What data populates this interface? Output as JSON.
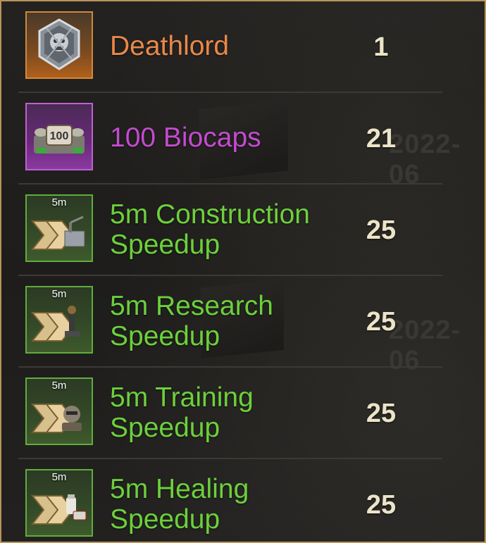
{
  "colors": {
    "frame_border": "#b8935a",
    "orange_text": "#e9884a",
    "purple_text": "#c44bd0",
    "green_text": "#6cd03c",
    "count_text": "#ece4c8"
  },
  "background": {
    "date_watermark_1": "2022-06",
    "date_watermark_2": "2022-06"
  },
  "items": [
    {
      "name_lines": [
        "Deathlord"
      ],
      "count": "1",
      "rarity": "orange",
      "icon": "deathlord-emblem-icon",
      "badge": ""
    },
    {
      "name_lines": [
        "100 Biocaps"
      ],
      "count": "21",
      "rarity": "purple",
      "icon": "biocaps-stack-icon",
      "badge": ""
    },
    {
      "name_lines": [
        "5m Construction",
        "Speedup"
      ],
      "count": "25",
      "rarity": "green",
      "icon": "construction-speedup-icon",
      "badge": "5m"
    },
    {
      "name_lines": [
        "5m Research",
        "Speedup"
      ],
      "count": "25",
      "rarity": "green",
      "icon": "research-speedup-icon",
      "badge": "5m"
    },
    {
      "name_lines": [
        "5m Training",
        "Speedup"
      ],
      "count": "25",
      "rarity": "green",
      "icon": "training-speedup-icon",
      "badge": "5m"
    },
    {
      "name_lines": [
        "5m Healing",
        "Speedup"
      ],
      "count": "25",
      "rarity": "green",
      "icon": "healing-speedup-icon",
      "badge": "5m"
    }
  ]
}
